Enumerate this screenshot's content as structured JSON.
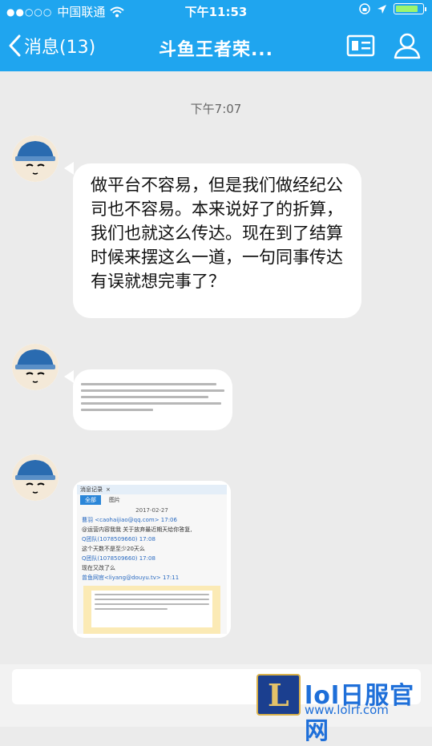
{
  "status_bar": {
    "carrier": "中国联通",
    "time": "下午11:53",
    "battery_level": 0.9
  },
  "nav": {
    "back_label": "消息(13)",
    "title": "斗鱼王者荣..."
  },
  "chat": {
    "timestamp": "下午7:07",
    "messages": [
      {
        "type": "text",
        "text": "做平台不容易，但是我们做经纪公司也不容易。本来说好了的折算，我们也就这么传达。现在到了结算时候来摆这么一道，一句同事传达有误就想完事了？"
      },
      {
        "type": "image",
        "description_lines": 7
      },
      {
        "type": "image-screenshot",
        "window_title": "消息记录",
        "tab_all": "全部",
        "tab_image": "图片",
        "date": "2017-02-27",
        "lines": [
          "曹羽 <caohaijiao@qq.com> 17:06",
          "@运营内容我我 关于放弃最近期天给你答复,",
          "Q团队(1078509660) 17:08",
          "这个天数不是至少20天么",
          "Q团队(1078509660) 17:08",
          "现在又改了么",
          "曾鱼网官<liyang@douyu.tv> 17:11"
        ]
      }
    ]
  },
  "watermark": {
    "logo_letter": "L",
    "title": "lol日服官网",
    "url": "www.lolrf.com"
  }
}
